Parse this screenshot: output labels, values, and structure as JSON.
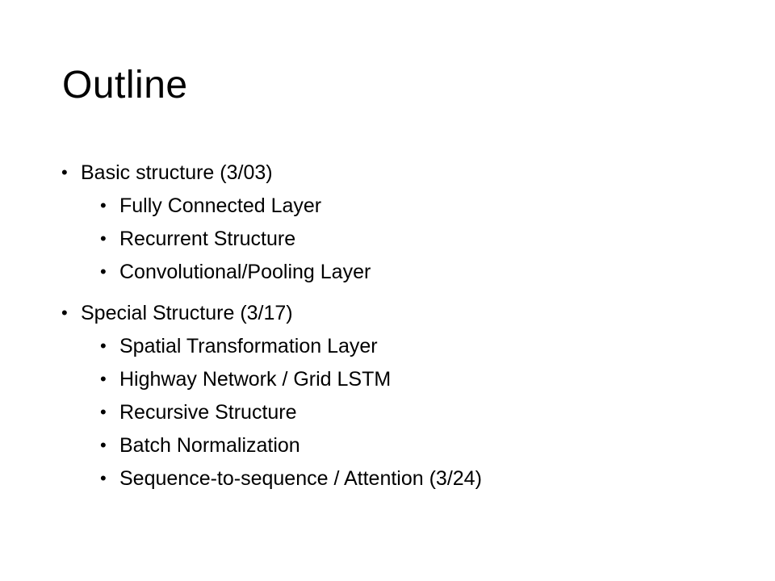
{
  "slide": {
    "title": "Outline",
    "bullet_glyph": "•",
    "sections": [
      {
        "label": "Basic structure (3/03)",
        "items": [
          "Fully Connected Layer",
          "Recurrent Structure",
          "Convolutional/Pooling Layer"
        ]
      },
      {
        "label": "Special Structure (3/17)",
        "items": [
          "Spatial Transformation Layer",
          "Highway Network / Grid LSTM",
          "Recursive Structure",
          "Batch Normalization",
          "Sequence-to-sequence / Attention (3/24)"
        ]
      }
    ]
  }
}
